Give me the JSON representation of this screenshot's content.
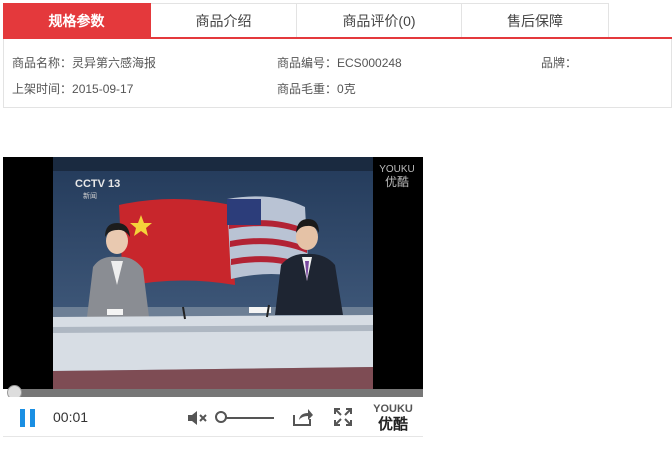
{
  "tabs": [
    {
      "label": "规格参数",
      "active": true
    },
    {
      "label": "商品介绍",
      "active": false
    },
    {
      "label": "商品评价(0)",
      "active": false
    },
    {
      "label": "售后保障",
      "active": false
    }
  ],
  "specs": {
    "name_label": "商品名称：",
    "name_value": "灵异第六感海报",
    "code_label": "商品编号：",
    "code_value": "ECS000248",
    "brand_label": "品牌：",
    "brand_value": "",
    "date_label": "上架时间：",
    "date_value": "2015-09-17",
    "weight_label": "商品毛重：",
    "weight_value": "0克"
  },
  "video": {
    "watermark_en": "YOUKU",
    "watermark_cn": "优酷",
    "channel_logo": "CCTV 13",
    "channel_sub": "新闻",
    "current_time": "00:01",
    "progress": 0.02,
    "volume": 0.0,
    "muted": true
  },
  "controls": {
    "pause_icon": "pause-icon",
    "mute_icon": "volume-muted-icon",
    "share_icon": "share-icon",
    "fullscreen_icon": "fullscreen-icon",
    "logo_en": "YOUKU",
    "logo_cn": "优酷"
  },
  "colors": {
    "accent": "#e4393c",
    "play_blue": "#1a8fe3"
  }
}
